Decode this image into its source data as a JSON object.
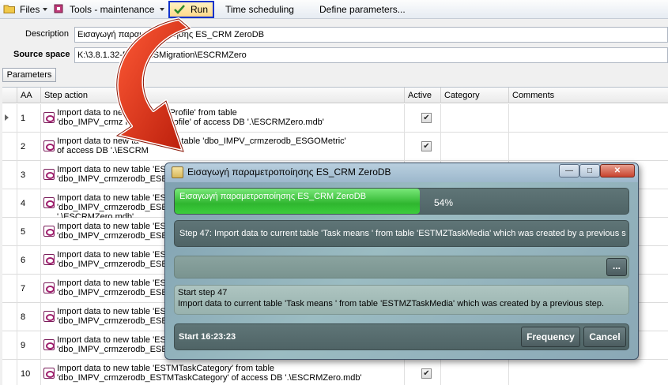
{
  "toolbar": {
    "files": "Files",
    "tools": "Tools - maintenance",
    "run": "Run",
    "time_scheduling": "Time scheduling",
    "define_parameters": "Define parameters..."
  },
  "form": {
    "description_label": "Description",
    "description_value": "Εισαγωγή παραμετροποίησης ES_CRM ZeroDB",
    "source_label": "Source space",
    "source_value": "K:\\3.8.1.32-P    L01\\ESMigration\\ESCRMZero",
    "parameters_tab": "Parameters"
  },
  "grid": {
    "columns": [
      "AA",
      "Step action",
      "Active",
      "Category",
      "Comments"
    ],
    "rows": [
      {
        "aa": "1",
        "line1": "Import data to ne              dPropertiesProfile' from table",
        "line2": "'dbo_IMPV_crmz                PropertiesProfile' of access DB '.\\ESCRMZero.mdb'",
        "line3": "",
        "active": true
      },
      {
        "aa": "2",
        "line1": "Import data to new ta              etric' from table 'dbo_IMPV_crmzerodb_ESGOMetric'",
        "line2": "of access DB '.\\ESCRM",
        "line3": "",
        "active": true
      },
      {
        "aa": "3",
        "line1": "Import data to new table 'ES",
        "line2": "'dbo_IMPV_crmzerodb_ESE",
        "line3": "",
        "active": false
      },
      {
        "aa": "4",
        "line1": "Import data to new table 'ES",
        "line2": "'dbo_IMPV_crmzerodb_ESE",
        "line3": "'.\\ESCRMZero.mdb'",
        "active": false
      },
      {
        "aa": "5",
        "line1": "Import data to new table 'ES",
        "line2": "'dbo_IMPV_crmzerodb_ESE",
        "line3": "",
        "active": false
      },
      {
        "aa": "6",
        "line1": "Import data to new table 'ES",
        "line2": "'dbo_IMPV_crmzerodb_ESE",
        "line3": "",
        "active": false
      },
      {
        "aa": "7",
        "line1": "Import data to new table 'ES",
        "line2": "'dbo_IMPV_crmzerodb_ESE",
        "line3": "",
        "active": false
      },
      {
        "aa": "8",
        "line1": "Import data to new table 'ES",
        "line2": "'dbo_IMPV_crmzerodb_ESE",
        "line3": "",
        "active": false
      },
      {
        "aa": "9",
        "line1": "Import data to new table 'ES",
        "line2": "'dbo_IMPV_crmzerodb_ESE",
        "line3": "",
        "active": false
      },
      {
        "aa": "10",
        "line1": "Import data to new table 'ESTMTaskCategory' from table",
        "line2": "'dbo_IMPV_crmzerodb_ESTMTaskCategory' of access DB '.\\ESCRMZero.mdb'",
        "line3": "",
        "active": true
      }
    ]
  },
  "dialog": {
    "title": "Εισαγωγή παραμετροποίησης ES_CRM ZeroDB",
    "progress_label": "Εισαγωγή παραμετροποίησης ES_CRM ZeroDB",
    "progress_percent": "54%",
    "progress_fraction": 0.54,
    "step_text": "Step 47: Import data to current table 'Task means ' from table 'ESTMZTaskMedia' which was created by a previous s",
    "more_button": "...",
    "log_line1": "Start step 47",
    "log_line2": "Import data to current table 'Task means ' from table 'ESTMZTaskMedia' which was created by a previous step.",
    "start_time": "Start 16:23:23",
    "frequency_button": "Frequency",
    "cancel_button": "Cancel"
  },
  "colors": {
    "highlight_border": "#1133cc",
    "arrow_red": "#d42a14",
    "progress_green": "#3ccd3c"
  },
  "icons": [
    "folder-icon",
    "tools-icon",
    "run-check-icon",
    "step-action-icon",
    "dialog-app-icon"
  ]
}
